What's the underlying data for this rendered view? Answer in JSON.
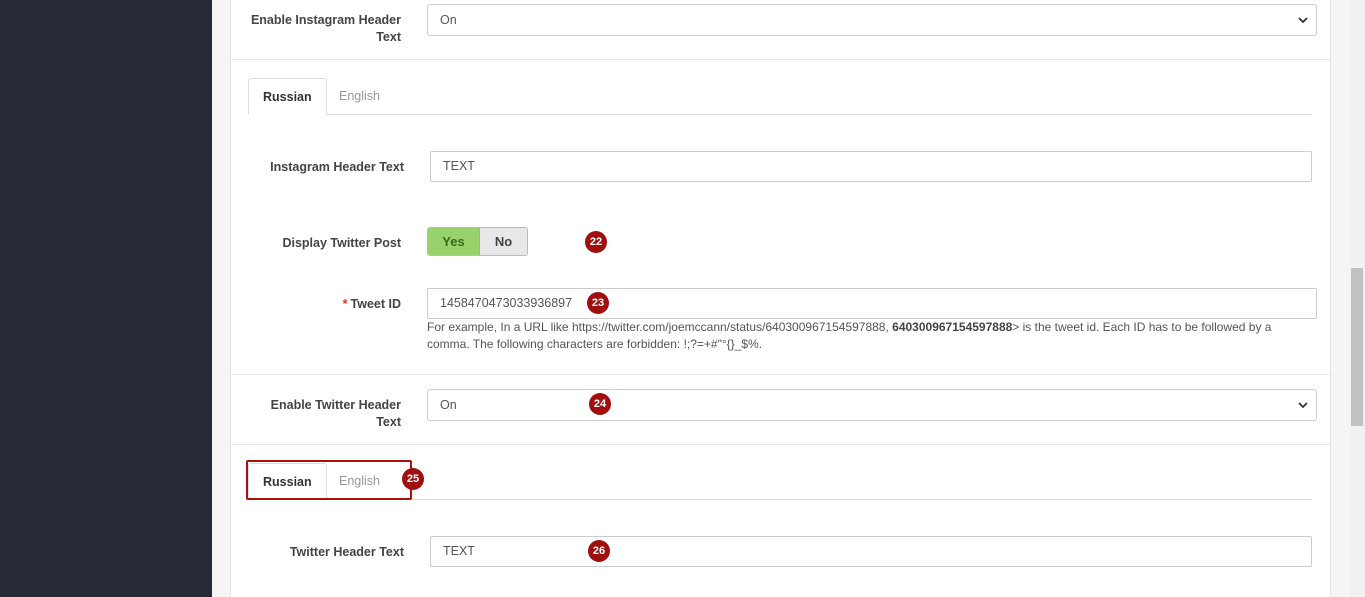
{
  "instagram_header": {
    "label": "Enable Instagram Header Text",
    "value": "On"
  },
  "instagram_tabs": [
    {
      "label": "Russian",
      "active": true
    },
    {
      "label": "English",
      "active": false
    }
  ],
  "instagram_text": {
    "label": "Instagram Header Text",
    "value": "TEXT"
  },
  "twitter_post": {
    "label": "Display Twitter Post",
    "yes": "Yes",
    "no": "No",
    "selected": "Yes"
  },
  "tweet_id": {
    "required_mark": "*",
    "label": "Tweet ID",
    "value": "1458470473033936897",
    "help_prefix": "For example, In a URL like https://twitter.com/joemccann/status/640300967154597888, ",
    "help_bold": "640300967154597888",
    "help_suffix": "> is the tweet id. Each ID has to be followed by a comma. The following characters are forbidden: !;?=+#\"°{}_$%."
  },
  "twitter_header": {
    "label": "Enable Twitter Header Text",
    "value": "On"
  },
  "twitter_tabs": [
    {
      "label": "Russian",
      "active": true
    },
    {
      "label": "English",
      "active": false
    }
  ],
  "twitter_text": {
    "label": "Twitter Header Text",
    "value": "TEXT"
  },
  "badges": [
    "22",
    "23",
    "24",
    "25",
    "26"
  ],
  "colors": {
    "sidebar": "#252a36",
    "toggle_on": "#97d36a",
    "badge": "#a00e0e"
  }
}
